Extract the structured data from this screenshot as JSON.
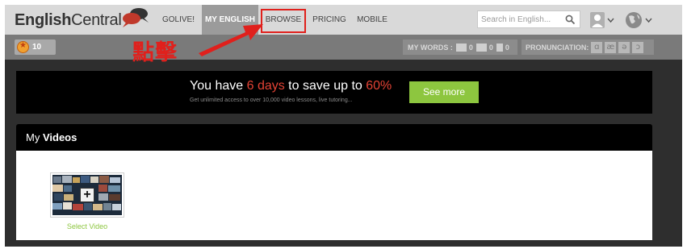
{
  "header": {
    "logo_main": "English",
    "logo_rest": "Central",
    "nav": [
      {
        "label": "GOLIVE!"
      },
      {
        "label": "MY ENGLISH"
      },
      {
        "label": "BROWSE"
      },
      {
        "label": "PRICING"
      },
      {
        "label": "MOBILE"
      }
    ],
    "search_placeholder": "Search in English..."
  },
  "subbar": {
    "coins": "10",
    "my_words_label": "MY WORDS :",
    "word_counts": [
      "0",
      "0",
      "0"
    ],
    "pronunciation_label": "PRONUNCIATION:",
    "phonemes": [
      "ɑ",
      "æ",
      "ə",
      "ɔ"
    ]
  },
  "annotation": {
    "text": "點擊"
  },
  "promo": {
    "prefix": "You have ",
    "days": "6 days",
    "middle": " to save up to ",
    "percent": "60%",
    "subtitle": "Get unlimited access to over 10,000 video lessons, live tutoring...",
    "button": "See more"
  },
  "videos": {
    "title_light": "My ",
    "title_bold": "Videos",
    "select_label": "Select Video"
  },
  "colors": {
    "accent_green": "#8dc63f",
    "annotation_red": "#e0201c",
    "promo_highlight": "#e34234"
  }
}
